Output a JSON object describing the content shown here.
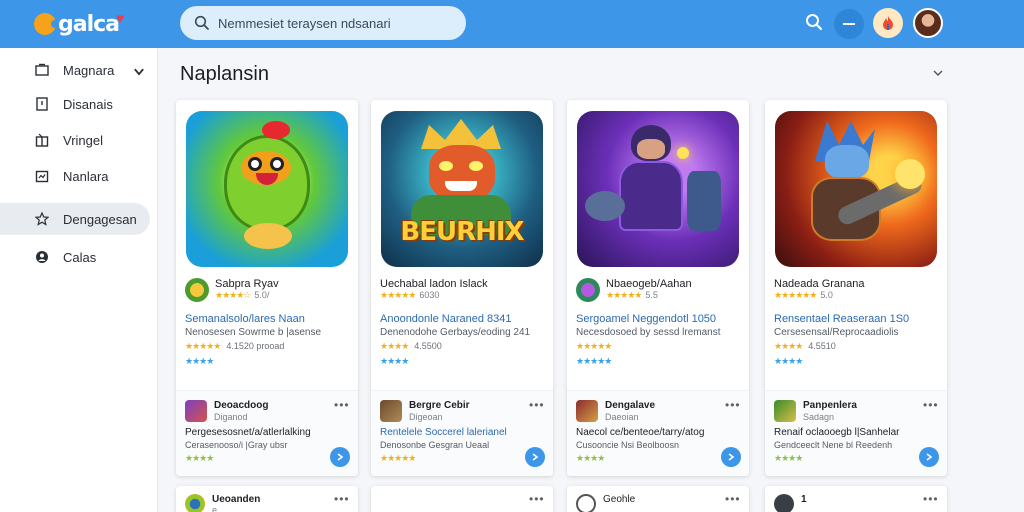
{
  "header": {
    "logo_text": "galca",
    "search_placeholder": "Nemmesiet teraysen ndsanari"
  },
  "sidebar": {
    "items": [
      {
        "label": "Magnara",
        "icon": "folder-icon"
      },
      {
        "label": "Disanais",
        "icon": "bookmark-icon"
      },
      {
        "label": "Vringel",
        "icon": "gift-icon"
      },
      {
        "label": "Nanlara",
        "icon": "calendar-icon"
      },
      {
        "label": "Dengagesan",
        "icon": "star-icon"
      },
      {
        "label": "Calas",
        "icon": "user-circle-icon"
      }
    ]
  },
  "main": {
    "title": "Naplansin"
  },
  "cards": [
    {
      "art_text": "",
      "app_name": "Sabpra Ryav",
      "app_meta": "5.0/",
      "sub_title": "Semanalsolo/lares Naan",
      "sub_desc": "Nenosesen Sowrme b |asense",
      "row_meta": "4.1520 prooad",
      "mini_name": "Deoacdoog",
      "mini_sub": "Diganod",
      "low_title": "Pergesesosnet/a/atlerlalking",
      "low_desc": "Cerasenooso/i |Gray ubsr",
      "bottom_name": "Ueoanden",
      "bottom_sub": "e"
    },
    {
      "art_text": "BEURHIX",
      "app_name": "Uechabal ladon Islack",
      "app_meta": "6030",
      "sub_title": "Anoondonle Naraned 8341",
      "sub_desc": "Denenodohe Gerbays/eoding 241",
      "row_meta": "4.5500",
      "mini_name": "Bergre Cebir",
      "mini_sub": "Digeoan",
      "low_title": "Rentelele Soccerel lalerianel",
      "low_desc": "Denosonbe Gesgran Ueaal",
      "bottom_name": "",
      "bottom_sub": ""
    },
    {
      "art_text": "",
      "app_name": "Nbaeogeb/Aahan",
      "app_meta": "5.5",
      "sub_title": "Sergoamel Neggendotl 1050",
      "sub_desc": "Necesdosoed by sessd lremanst",
      "row_meta": "",
      "mini_name": "Dengalave",
      "mini_sub": "Daeoian",
      "low_title": "Naecol ce/benteoe/tarry/atog",
      "low_desc": "Cusooncie Nsi Beolboosn",
      "bottom_name": "Geohle",
      "bottom_sub": ""
    },
    {
      "art_text": "",
      "app_name": "Nadeada Granana",
      "app_meta": "5.0",
      "sub_title": "Rensentael Reaseraan 1S0",
      "sub_desc": "Cersesensal/Reprocaadiolis",
      "row_meta": "4.5510",
      "mini_name": "Panpenlera",
      "mini_sub": "Sadagn",
      "low_title": "Renaif oclaooegb l|Sanhelar",
      "low_desc": "Gendceeclt Nene bl Reedenh",
      "bottom_name": "1",
      "bottom_sub": ""
    }
  ]
}
